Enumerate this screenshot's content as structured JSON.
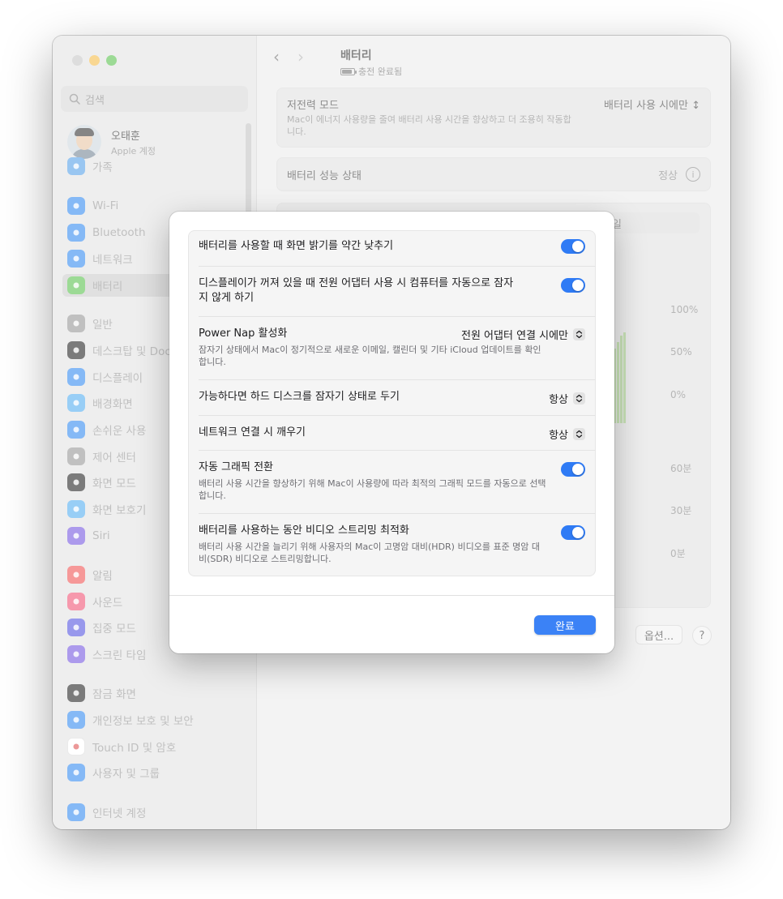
{
  "colors": {
    "accent": "#2f7bf5",
    "traffic_close": "#c8c8c8",
    "traffic_min": "#f5bf4f",
    "traffic_max": "#5fc454"
  },
  "sidebar": {
    "search_placeholder": "검색",
    "profile": {
      "name": "오태훈",
      "sub": "Apple 계정"
    },
    "items": [
      {
        "label": "가족",
        "icon": "family-icon",
        "color": "#5ba4e8"
      },
      {
        "label": "Wi-Fi",
        "icon": "wifi-icon",
        "color": "#3b8ef0"
      },
      {
        "label": "Bluetooth",
        "icon": "bluetooth-icon",
        "color": "#3b8ef0"
      },
      {
        "label": "네트워크",
        "icon": "globe-icon",
        "color": "#3b8ef0"
      },
      {
        "label": "배터리",
        "icon": "battery-icon",
        "color": "#5fc454"
      },
      {
        "label": "일반",
        "icon": "gear-icon",
        "color": "#9a9a9a"
      },
      {
        "label": "데스크탑 및 Dock",
        "icon": "dock-icon",
        "color": "#2a2a2a"
      },
      {
        "label": "디스플레이",
        "icon": "sun-icon",
        "color": "#3b8ef0"
      },
      {
        "label": "배경화면",
        "icon": "flower-icon",
        "color": "#5ab0f0"
      },
      {
        "label": "손쉬운 사용",
        "icon": "accessibility-icon",
        "color": "#3b8ef0"
      },
      {
        "label": "제어 센터",
        "icon": "control-center-icon",
        "color": "#9a9a9a"
      },
      {
        "label": "화면 모드",
        "icon": "appearance-icon",
        "color": "#2a2a2a"
      },
      {
        "label": "화면 보호기",
        "icon": "screensaver-icon",
        "color": "#5ab0f0"
      },
      {
        "label": "Siri",
        "icon": "siri-icon",
        "color": "#7a5ce0"
      },
      {
        "label": "알림",
        "icon": "bell-icon",
        "color": "#f05a5a"
      },
      {
        "label": "사운드",
        "icon": "speaker-icon",
        "color": "#f05a7a"
      },
      {
        "label": "집중 모드",
        "icon": "moon-icon",
        "color": "#5a5ae0"
      },
      {
        "label": "스크린 타임",
        "icon": "hourglass-icon",
        "color": "#7a5ce0"
      },
      {
        "label": "잠금 화면",
        "icon": "lock-icon",
        "color": "#2a2a2a"
      },
      {
        "label": "개인정보 보호 및 보안",
        "icon": "hand-icon",
        "color": "#3b8ef0"
      },
      {
        "label": "Touch ID 및 암호",
        "icon": "fingerprint-icon",
        "color": "#ffffff"
      },
      {
        "label": "사용자 및 그룹",
        "icon": "users-icon",
        "color": "#3b8ef0"
      },
      {
        "label": "인터넷 계정",
        "icon": "at-icon",
        "color": "#3b8ef0"
      }
    ]
  },
  "header": {
    "title": "배터리",
    "subtitle": "충전 완료됨"
  },
  "background": {
    "low_power": {
      "label": "저전력 모드",
      "value": "배터리 사용 시에만",
      "desc": "Mac이 에너지 사용량을 줄여 배터리 사용 시간을 향상하고 더 조용히 작동합니다."
    },
    "health": {
      "label": "배터리 성능 상태",
      "value": "정상"
    },
    "segment_tail": "일",
    "chart_labels_top": [
      "100%",
      "50%",
      "0%"
    ],
    "chart_labels_bottom": [
      "60분",
      "30분",
      "0분"
    ],
    "options_button": "옵션...",
    "help_button": "?"
  },
  "sheet": {
    "options": [
      {
        "label": "배터리를 사용할 때 화면 밝기를 약간 낮추기",
        "desc": "",
        "control": "toggle",
        "on": true
      },
      {
        "label": "디스플레이가 꺼져 있을 때 전원 어댑터 사용 시 컴퓨터를 자동으로 잠자지 않게 하기",
        "desc": "",
        "control": "toggle",
        "on": true
      },
      {
        "label": "Power Nap 활성화",
        "desc": "잠자기 상태에서 Mac이 정기적으로 새로운 이메일, 캘린더 및 기타 iCloud 업데이트를 확인합니다.",
        "control": "popup",
        "value": "전원 어댑터 연결 시에만"
      },
      {
        "label": "가능하다면 하드 디스크를 잠자기 상태로 두기",
        "desc": "",
        "control": "popup",
        "value": "항상"
      },
      {
        "label": "네트워크 연결 시 깨우기",
        "desc": "",
        "control": "popup",
        "value": "항상"
      },
      {
        "label": "자동 그래픽 전환",
        "desc": "배터리 사용 시간을 향상하기 위해 Mac이 사용량에 따라 최적의 그래픽 모드를 자동으로 선택합니다.",
        "control": "toggle",
        "on": true
      },
      {
        "label": "배터리를 사용하는 동안 비디오 스트리밍 최적화",
        "desc": "배터리 사용 시간을 늘리기 위해 사용자의 Mac이 고명암 대비(HDR) 비디오를 표준 명암 대비(SDR) 비디오로 스트리밍합니다.",
        "control": "toggle",
        "on": true
      }
    ],
    "done_button": "완료"
  }
}
